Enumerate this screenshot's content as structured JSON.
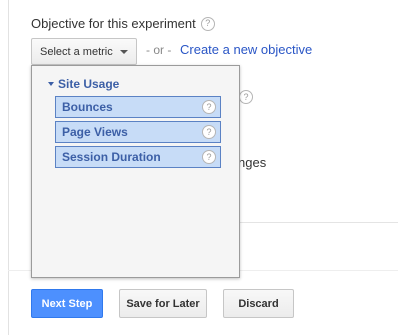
{
  "objective": {
    "label": "Objective for this experiment",
    "help_icon": "?"
  },
  "metric_select": {
    "placeholder": "Select a metric"
  },
  "separator": "- or -",
  "create_link": "Create a new objective",
  "background": {
    "help_icon": "?",
    "changes_fragment": "nges"
  },
  "dropdown": {
    "group": {
      "label": "Site Usage",
      "items": [
        {
          "label": "Bounces",
          "help_icon": "?"
        },
        {
          "label": "Page Views",
          "help_icon": "?"
        },
        {
          "label": "Session Duration",
          "help_icon": "?"
        }
      ]
    }
  },
  "buttons": {
    "next": "Next Step",
    "save": "Save for Later",
    "discard": "Discard"
  },
  "colors": {
    "primary_button": "#4d90fe",
    "link": "#2a56c6",
    "metric_item_bg": "#c7dcf7",
    "metric_item_text": "#3c5fa6"
  }
}
